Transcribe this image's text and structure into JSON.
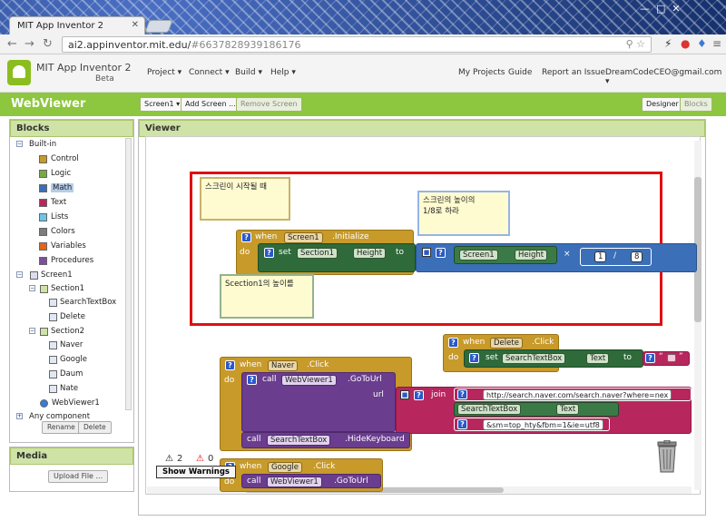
{
  "browser": {
    "tab_title": "MIT App Inventor 2",
    "url_host": "ai2.appinventor.mit.edu/",
    "url_hash": "#6637828939186176"
  },
  "app": {
    "name": "MIT App Inventor 2",
    "beta": "Beta",
    "menus": [
      "Project ▾",
      "Connect ▾",
      "Build ▾",
      "Help ▾"
    ],
    "right_menus": [
      "My Projects",
      "Guide",
      "Report an Issue",
      "DreamCodeCEO@gmail.com ▾"
    ]
  },
  "project": {
    "name": "WebViewer",
    "screen_btn": "Screen1 ▾",
    "add_screen": "Add Screen ...",
    "remove_screen": "Remove Screen",
    "designer": "Designer",
    "blocks": "Blocks"
  },
  "blocks_panel": {
    "title": "Blocks",
    "builtin": "Built-in",
    "builtin_items": [
      {
        "label": "Control",
        "color": "#c79a2a"
      },
      {
        "label": "Logic",
        "color": "#77ab41"
      },
      {
        "label": "Math",
        "color": "#3b6fb8"
      },
      {
        "label": "Text",
        "color": "#b8265e"
      },
      {
        "label": "Lists",
        "color": "#6fc3e8"
      },
      {
        "label": "Colors",
        "color": "#7c7c7c"
      },
      {
        "label": "Variables",
        "color": "#e0661c"
      },
      {
        "label": "Procedures",
        "color": "#7b4fa0"
      }
    ],
    "screen1": "Screen1",
    "section1": "Section1",
    "section1_items": [
      "SearchTextBox",
      "Delete"
    ],
    "section2": "Section2",
    "section2_items": [
      "Naver",
      "Google",
      "Daum",
      "Nate"
    ],
    "webviewer": "WebViewer1",
    "any_component": "Any component",
    "rename": "Rename",
    "delete": "Delete"
  },
  "media_panel": {
    "title": "Media",
    "upload": "Upload File ..."
  },
  "viewer": {
    "title": "Viewer",
    "warnings_count": "2",
    "errors_count": "0",
    "show_warnings": "Show Warnings"
  },
  "workspace": {
    "note1": "스크린이 시작될 때",
    "note2_line1": "스크린의 높이의",
    "note2_line2": "1/8로 하라",
    "note3": "Scection1의 높이를",
    "init_when": "when",
    "init_screen": "Screen1",
    "init_event": ".Initialize",
    "do": "do",
    "set": "set",
    "section1": "Section1",
    "height": "Height",
    "to": "to",
    "screen1": "Screen1",
    "times": "×",
    "num1": "1",
    "slash": "/",
    "num8": "8",
    "delete_when": "when",
    "delete_comp": "Delete",
    "click": ".Click",
    "searchtextbox": "SearchTextBox",
    "text_prop": "Text",
    "empty_str_q1": "“",
    "empty_str_q2": "”",
    "naver_when": "when",
    "naver_comp": "Naver",
    "call": "call",
    "webviewer1": "WebViewer1",
    "gotourl": ".GoToUrl",
    "url": "url",
    "join": "join",
    "naver_url": "http://search.naver.com/search.naver?where=nex",
    "naver_suffix": "&sm=top_hty&fbm=1&ie=utf8",
    "hidekeyboard": ".HideKeyboard",
    "google_when": "when",
    "google_comp": "Google"
  }
}
